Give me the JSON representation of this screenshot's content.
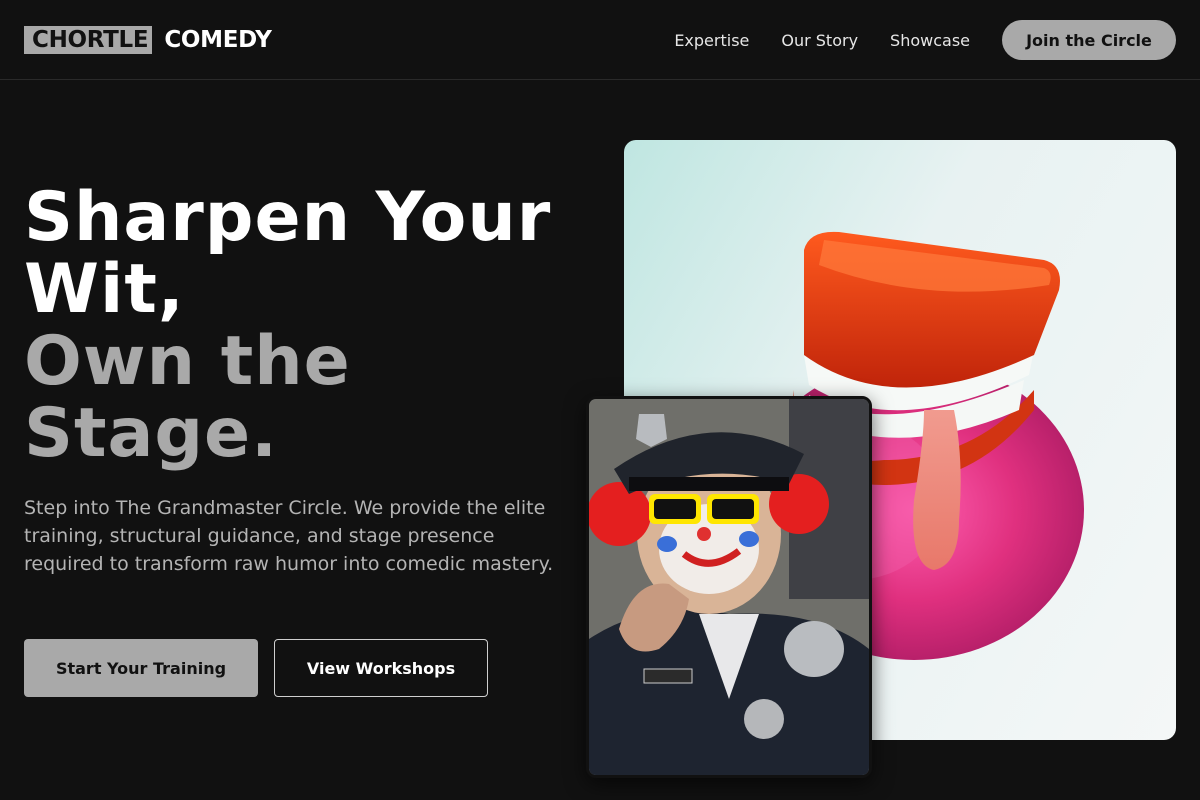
{
  "brand": {
    "box_text": "CHORTLE",
    "text": "COMEDY"
  },
  "nav": {
    "links": [
      "Expertise",
      "Our Story",
      "Showcase"
    ],
    "cta": "Join the Circle"
  },
  "hero": {
    "title_line1": "Sharpen Your",
    "title_line2": "Wit,",
    "title_line3": "Own the",
    "title_line4": "Stage.",
    "description": "Step into The Grandmaster Circle. We provide the elite training, structural guidance, and stage presence required to transform raw humor into comedic mastery.",
    "primary_button": "Start Your Training",
    "secondary_button": "View Workshops"
  },
  "colors": {
    "background": "#111111",
    "accent_grey": "#a9a9a9",
    "text_white": "#ffffff",
    "text_muted": "#b4b4b4"
  },
  "images": {
    "main": "wind-up-chattering-teeth-photo",
    "secondary": "clown-police-officer-pointing-photo"
  }
}
